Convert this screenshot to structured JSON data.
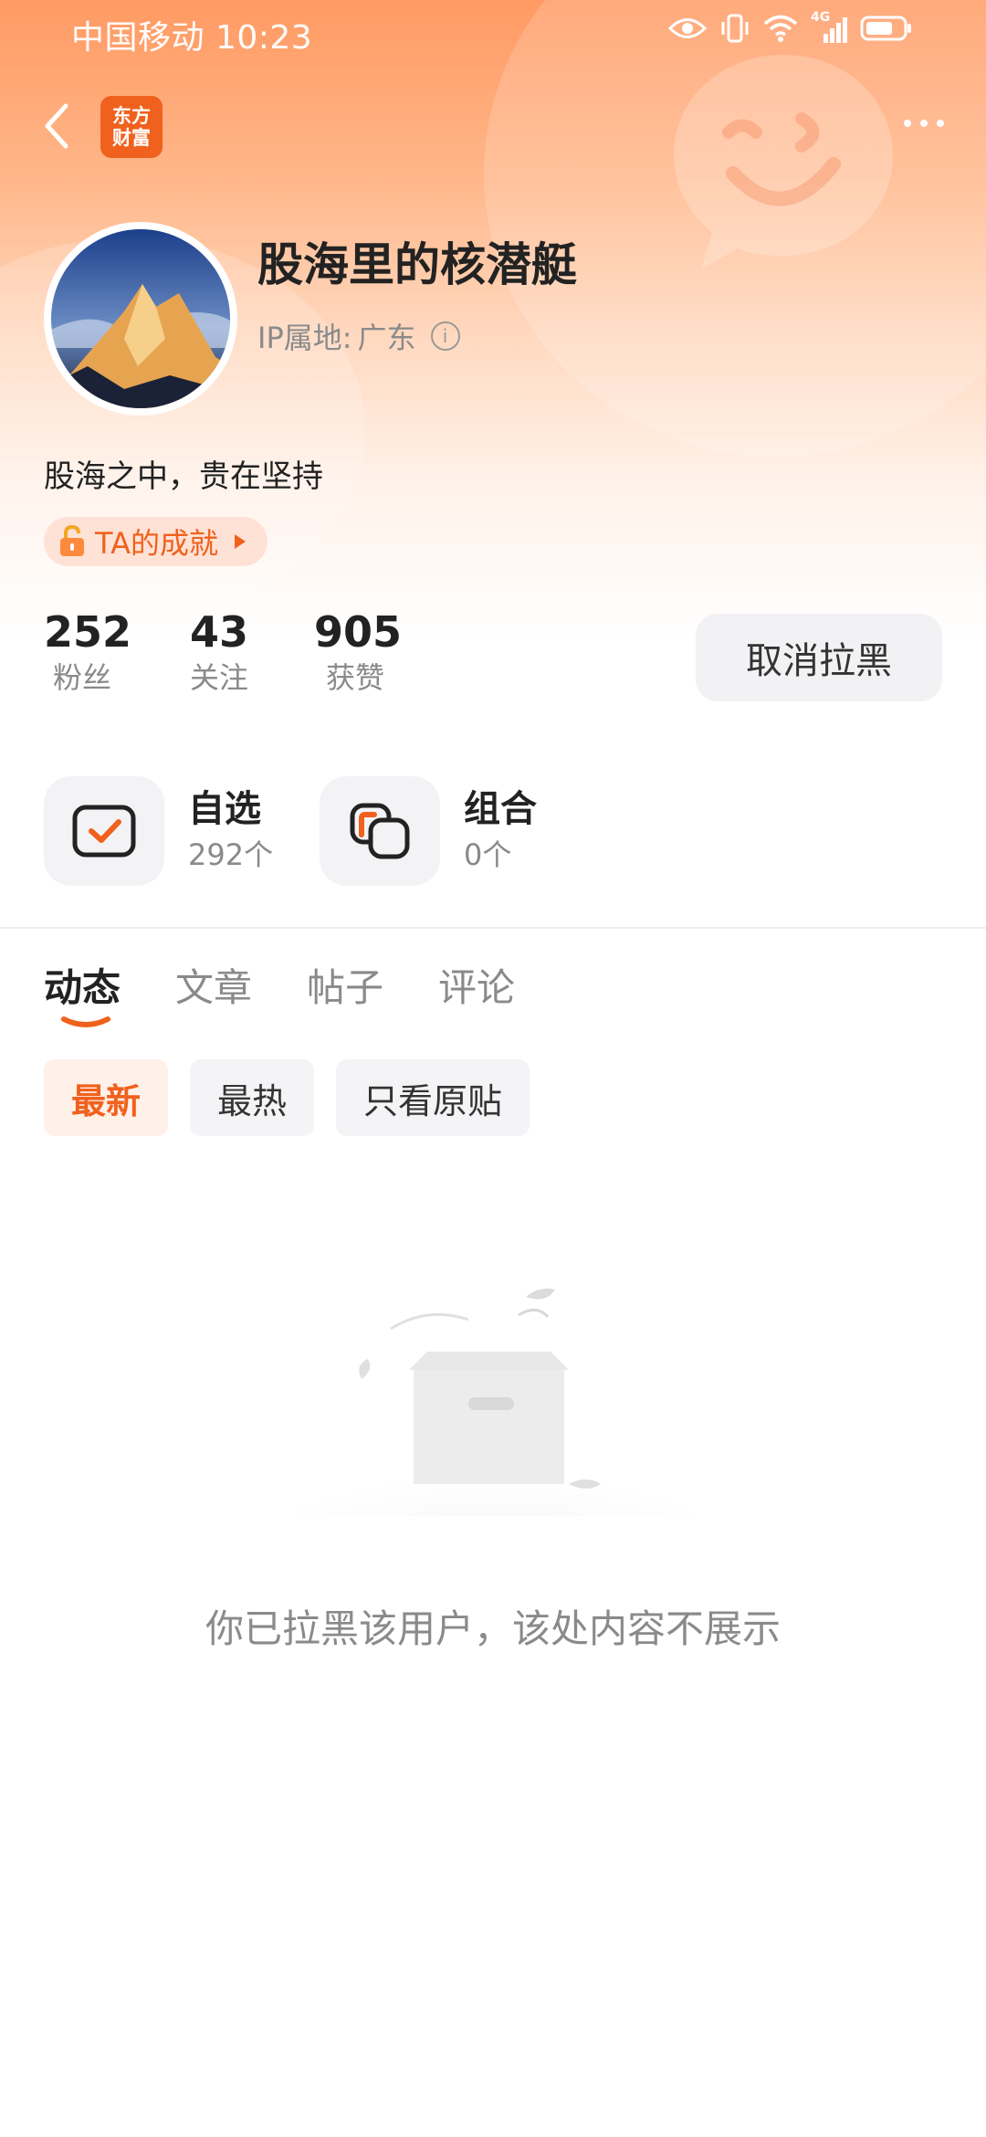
{
  "status_bar": {
    "carrier": "中国移动",
    "time": "10:23",
    "network": "4G"
  },
  "header": {
    "app_logo_line1": "东方",
    "app_logo_line2": "财富"
  },
  "profile": {
    "username": "股海里的核潜艇",
    "ip_label": "IP属地:",
    "ip_value": "广东",
    "bio": "股海之中，贵在坚持",
    "achievement_label": "TA的成就"
  },
  "stats": [
    {
      "value": "252",
      "label": "粉丝"
    },
    {
      "value": "43",
      "label": "关注"
    },
    {
      "value": "905",
      "label": "获赞"
    }
  ],
  "unblock_button": "取消拉黑",
  "quick_entries": [
    {
      "title": "自选",
      "count": "292个"
    },
    {
      "title": "组合",
      "count": "0个"
    }
  ],
  "tabs": [
    {
      "label": "动态",
      "active": true
    },
    {
      "label": "文章",
      "active": false
    },
    {
      "label": "帖子",
      "active": false
    },
    {
      "label": "评论",
      "active": false
    }
  ],
  "filters": [
    {
      "label": "最新",
      "active": true
    },
    {
      "label": "最热",
      "active": false
    },
    {
      "label": "只看原贴",
      "active": false
    }
  ],
  "empty_message": "你已拉黑该用户，该处内容不展示",
  "colors": {
    "brand": "#f0611d",
    "header_top": "#ff9a63"
  }
}
